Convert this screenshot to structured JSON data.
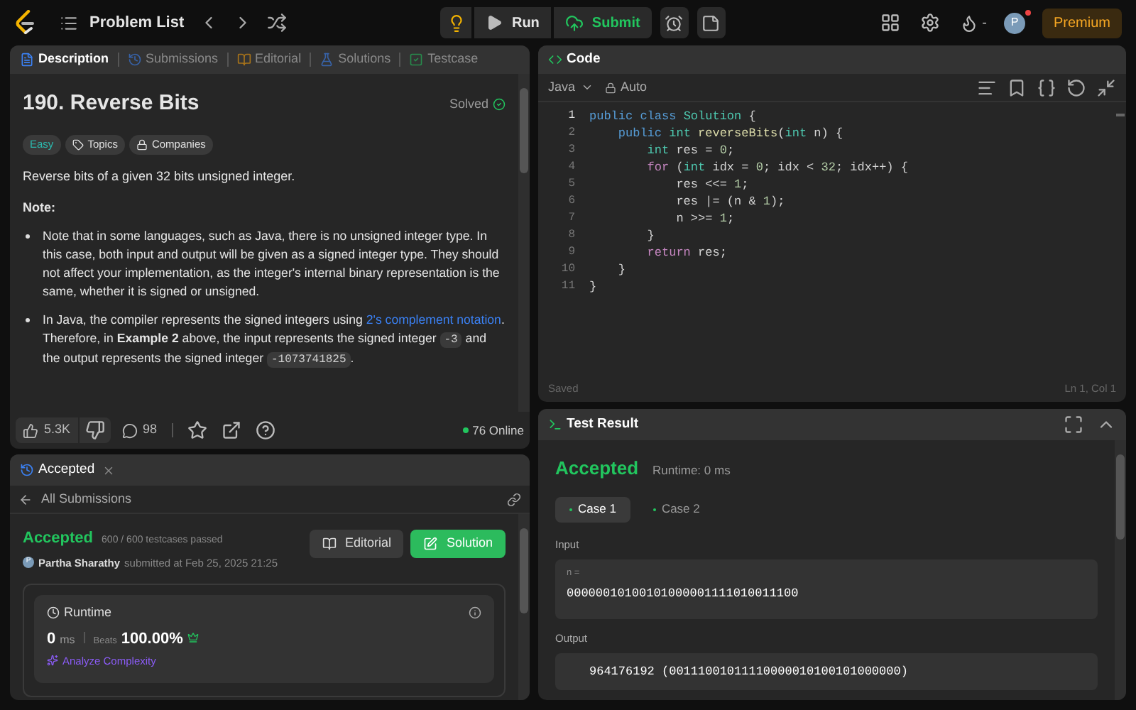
{
  "top_bar": {
    "title": "Problem List",
    "run": "Run",
    "submit": "Submit",
    "streak": "-",
    "avatar": "P",
    "premium": "Premium"
  },
  "description_panel": {
    "tabs": [
      {
        "label": "Description",
        "selected": true,
        "kind": "description"
      },
      {
        "label": "Submissions",
        "selected": false,
        "kind": "submissions"
      },
      {
        "label": "Editorial",
        "selected": false,
        "kind": "editorial"
      },
      {
        "label": "Solutions",
        "selected": false,
        "kind": "solutions"
      },
      {
        "label": "Testcase",
        "selected": false,
        "kind": "testcase"
      }
    ],
    "title": "190. Reverse Bits",
    "status": "Solved",
    "tags": [
      {
        "label": "Easy",
        "kind": "difficulty"
      },
      {
        "label": "Topics",
        "kind": "topics"
      },
      {
        "label": "Companies",
        "kind": "companies"
      }
    ],
    "intro": "Reverse bits of a given 32 bits unsigned integer.",
    "note_label": "Note:",
    "bullets": [
      [
        {
          "kind": "text",
          "text": "Note that in some languages, such as Java, there is no unsigned integer type. In this case, both input and output will be given as a signed integer type. They should not affect your implementation, as the integer's internal binary representation is the same, whether it is signed or unsigned."
        }
      ],
      [
        {
          "kind": "text",
          "text": "In Java, the compiler represents the signed integers using "
        },
        {
          "kind": "link",
          "text": "2's complement notation"
        },
        {
          "kind": "text",
          "text": ". Therefore, in **Example 2** above, the input represents the signed integer "
        },
        {
          "kind": "code",
          "text": "-3"
        },
        {
          "kind": "text",
          "text": " and the output represents the signed integer "
        },
        {
          "kind": "code",
          "text": "-1073741825"
        },
        {
          "kind": "text",
          "text": "."
        }
      ]
    ],
    "likes": "5.3K",
    "comments": "98",
    "online": "76 Online"
  },
  "submission_panel": {
    "tab": "Accepted",
    "back": "All Submissions",
    "status": "Accepted",
    "testcases": "600 / 600 testcases passed",
    "avatar": "P",
    "user": "Partha Sharathy",
    "submitted": "submitted at Feb 25, 2025 21:25",
    "editorial": "Editorial",
    "solution": "Solution",
    "runtime": {
      "title": "Runtime",
      "value": "0",
      "unit": "ms",
      "beats_label": "Beats",
      "beats": "100.00%",
      "analyze": "Analyze Complexity"
    }
  },
  "code_panel": {
    "title": "Code",
    "language": "Java",
    "mode": "Auto",
    "lines": [
      [
        {
          "kind": "keyword",
          "text": "public class"
        },
        {
          "kind": "class",
          "text": " Solution"
        },
        {
          "kind": "plain",
          "text": " {"
        }
      ],
      [
        {
          "kind": "keyword",
          "text": "    public"
        },
        {
          "kind": "type",
          "text": " int"
        },
        {
          "kind": "function",
          "text": " reverseBits"
        },
        {
          "kind": "plain",
          "text": "("
        },
        {
          "kind": "type",
          "text": "int"
        },
        {
          "kind": "plain",
          "text": " n) {"
        }
      ],
      [
        {
          "kind": "type",
          "text": "        int"
        },
        {
          "kind": "plain",
          "text": " res = "
        },
        {
          "kind": "number",
          "text": "0"
        },
        {
          "kind": "plain",
          "text": ";"
        }
      ],
      [
        {
          "kind": "control",
          "text": "        for"
        },
        {
          "kind": "plain",
          "text": " ("
        },
        {
          "kind": "type",
          "text": "int"
        },
        {
          "kind": "plain",
          "text": " idx = "
        },
        {
          "kind": "number",
          "text": "0"
        },
        {
          "kind": "plain",
          "text": "; idx < "
        },
        {
          "kind": "number",
          "text": "32"
        },
        {
          "kind": "plain",
          "text": "; idx++) {"
        }
      ],
      [
        {
          "kind": "plain",
          "text": "            res <<= "
        },
        {
          "kind": "number",
          "text": "1"
        },
        {
          "kind": "plain",
          "text": ";"
        }
      ],
      [
        {
          "kind": "plain",
          "text": "            res |= (n & "
        },
        {
          "kind": "number",
          "text": "1"
        },
        {
          "kind": "plain",
          "text": ");"
        }
      ],
      [
        {
          "kind": "plain",
          "text": "            n >>= "
        },
        {
          "kind": "number",
          "text": "1"
        },
        {
          "kind": "plain",
          "text": ";"
        }
      ],
      [
        {
          "kind": "plain",
          "text": "        }"
        }
      ],
      [
        {
          "kind": "control",
          "text": "        return"
        },
        {
          "kind": "plain",
          "text": " res;"
        }
      ],
      [
        {
          "kind": "plain",
          "text": "    }"
        }
      ],
      [
        {
          "kind": "plain",
          "text": "}"
        }
      ]
    ],
    "line_numbers": [
      "1",
      "2",
      "3",
      "4",
      "5",
      "6",
      "7",
      "8",
      "9",
      "10",
      "11"
    ],
    "saved": "Saved",
    "cursor": "Ln 1, Col 1"
  },
  "test_result": {
    "title": "Test Result",
    "verdict": "Accepted",
    "runtime": "Runtime: 0 ms",
    "cases": [
      {
        "label": "Case 1",
        "selected": true
      },
      {
        "label": "Case 2",
        "selected": false
      }
    ],
    "input_label": "Input",
    "input_name": "n =",
    "input_value": "00000010100101000001111010011100",
    "output_label": "Output",
    "output_value": "964176192 (00111001011110000010100101000000)"
  }
}
